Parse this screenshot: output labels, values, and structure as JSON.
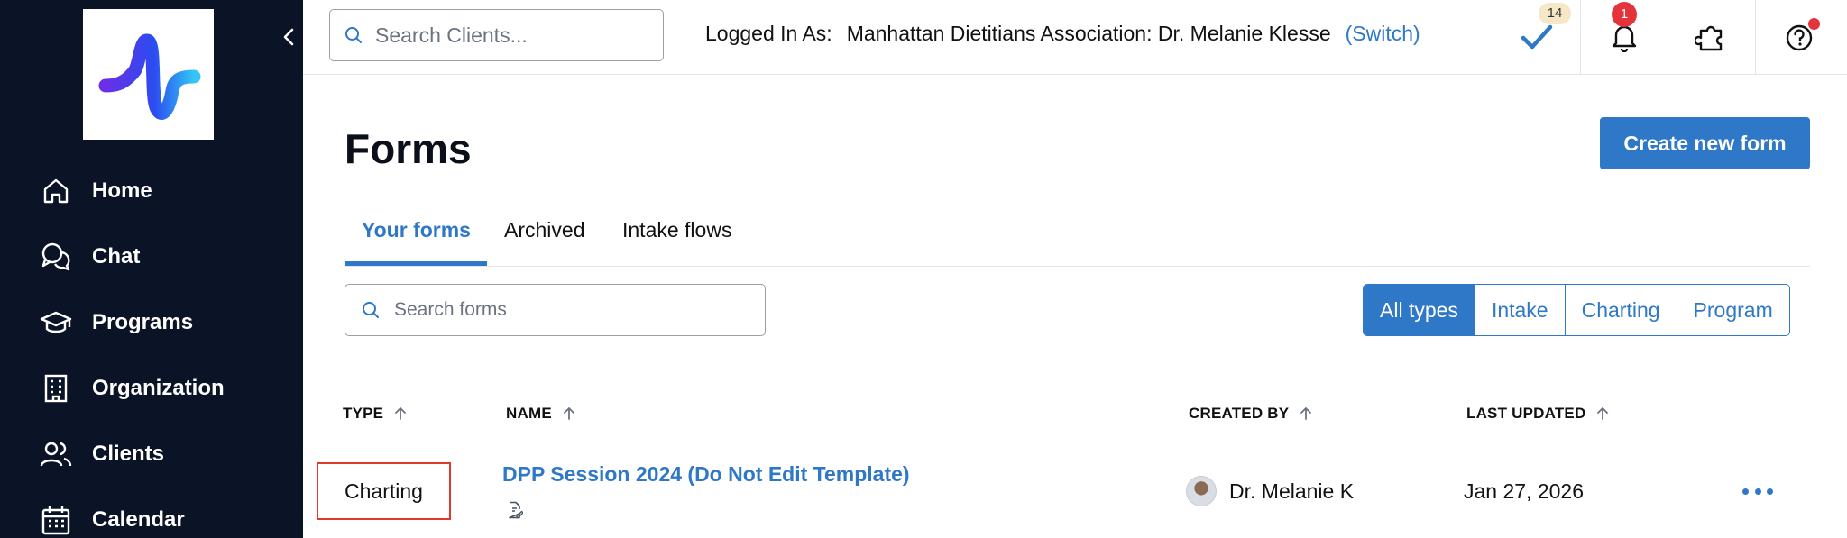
{
  "sidebar": {
    "items": [
      {
        "label": "Home",
        "icon": "home-icon"
      },
      {
        "label": "Chat",
        "icon": "chat-icon"
      },
      {
        "label": "Programs",
        "icon": "graduation-cap-icon"
      },
      {
        "label": "Organization",
        "icon": "building-icon"
      },
      {
        "label": "Clients",
        "icon": "users-icon"
      },
      {
        "label": "Calendar",
        "icon": "calendar-icon"
      }
    ]
  },
  "header": {
    "client_search_placeholder": "Search Clients...",
    "logged_in_label": "Logged In As:",
    "account_name": "Manhattan Dietitians Association: Dr. Melanie Klesse",
    "switch_label": "(Switch)",
    "tasks_count": "14",
    "notifications_count": "1"
  },
  "main": {
    "title": "Forms",
    "create_button": "Create new form",
    "tabs": [
      {
        "label": "Your forms",
        "active": true
      },
      {
        "label": "Archived",
        "active": false
      },
      {
        "label": "Intake flows",
        "active": false
      }
    ],
    "form_search_placeholder": "Search forms",
    "filters": [
      {
        "label": "All types",
        "active": true
      },
      {
        "label": "Intake",
        "active": false
      },
      {
        "label": "Charting",
        "active": false
      },
      {
        "label": "Program",
        "active": false
      }
    ],
    "table": {
      "columns": [
        "TYPE",
        "NAME",
        "CREATED BY",
        "LAST UPDATED"
      ],
      "rows": [
        {
          "type": "Charting",
          "name": "DPP Session 2024 (Do Not Edit Template)",
          "created_by": "Dr. Melanie K",
          "last_updated": "Jan 27, 2026"
        }
      ]
    }
  },
  "colors": {
    "sidebar_bg": "#0b1326",
    "accent": "#2f78c8",
    "highlight_border": "#e2382c",
    "badge_red": "#e5333b"
  }
}
